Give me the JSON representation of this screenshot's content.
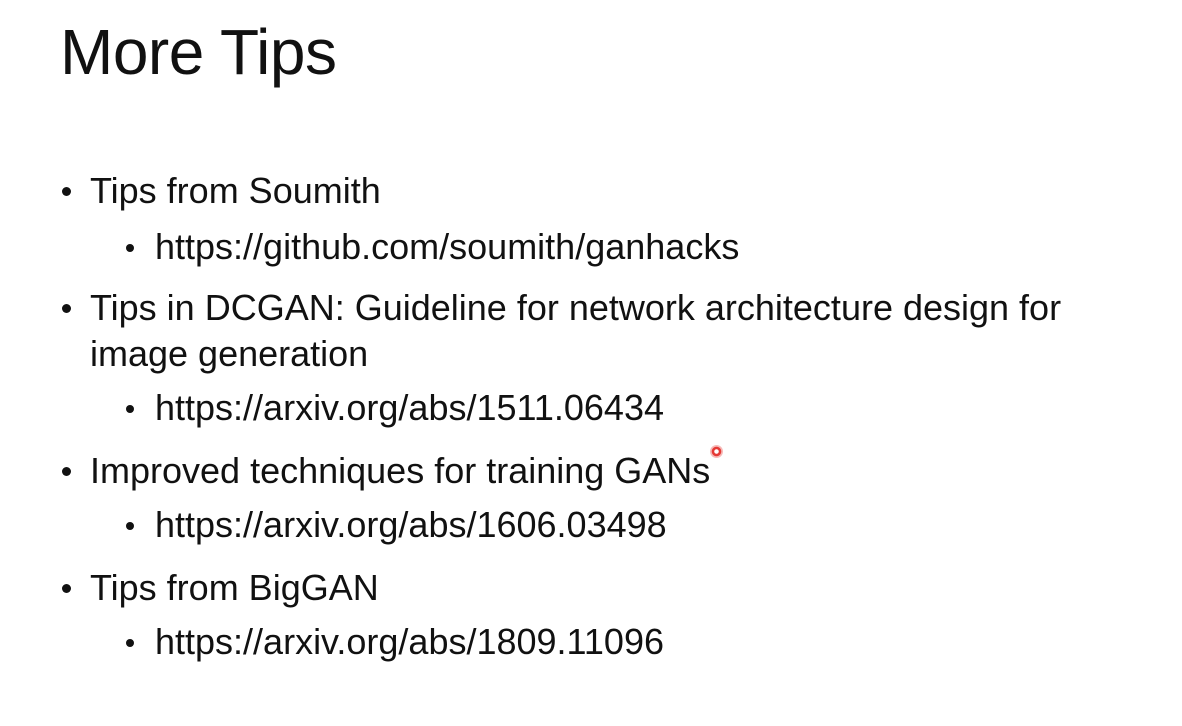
{
  "slide": {
    "title": "More Tips",
    "items": [
      {
        "text": "Tips from Soumith",
        "sub": "https://github.com/soumith/ganhacks"
      },
      {
        "text": "Tips in DCGAN: Guideline for network architecture design for image generation",
        "sub": "https://arxiv.org/abs/1511.06434"
      },
      {
        "text": "Improved techniques for training GANs",
        "sub": "https://arxiv.org/abs/1606.03498"
      },
      {
        "text": "Tips from BigGAN",
        "sub": "https://arxiv.org/abs/1809.11096"
      }
    ]
  },
  "colors": {
    "background": "#ffffff",
    "text": "#111111",
    "laser_pointer": "#e53935"
  }
}
